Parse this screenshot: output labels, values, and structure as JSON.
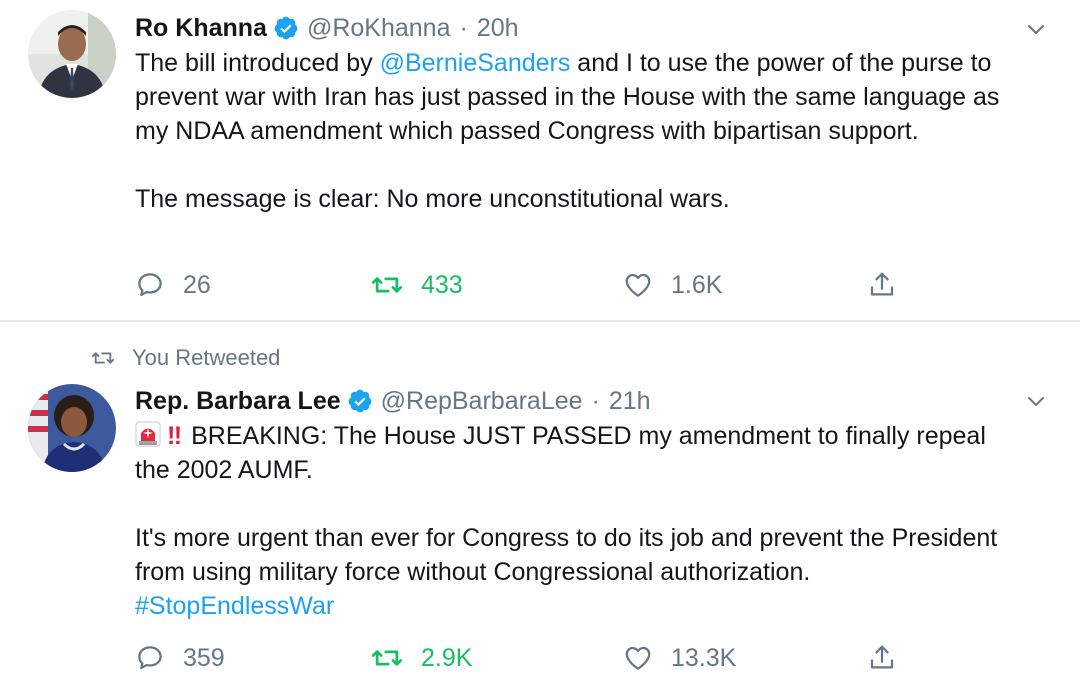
{
  "tweets": [
    {
      "display_name": "Ro Khanna",
      "handle": "@RoKhanna",
      "separator": "·",
      "time": "20h",
      "text_before_mention": "The bill introduced by ",
      "mention": "@BernieSanders",
      "text_after_mention": " and I to use the power of the purse to prevent war with Iran has just passed in the House with the same language as my NDAA amendment which passed Congress with bipartisan support.",
      "paragraph_2": "The message is clear: No more unconstitutional wars.",
      "reply_count": "26",
      "retweet_count": "433",
      "like_count": "1.6K",
      "retweeted": true
    },
    {
      "social_context": "You Retweeted",
      "display_name": "Rep. Barbara Lee",
      "handle": "@RepBarbaraLee",
      "separator": "·",
      "time": "21h",
      "emoji_bangbang": "‼",
      "text_1": "BREAKING: The House JUST PASSED my amendment to finally repeal the 2002 AUMF.",
      "paragraph_2": "It's more urgent than ever for Congress to do its job and prevent the President from using military force without Congressional authorization.",
      "hashtag": "#StopEndlessWar",
      "reply_count": "359",
      "retweet_count": "2.9K",
      "like_count": "13.3K",
      "retweeted": true
    }
  ],
  "icons": {
    "verified": "verified-badge-icon",
    "caret": "chevron-down-icon",
    "reply": "reply-bubble-icon",
    "retweet": "retweet-arrows-icon",
    "like": "heart-outline-icon",
    "share": "share-upload-icon",
    "siren": "rotating-light-emoji"
  },
  "colors": {
    "link_blue": "#1da1f2",
    "retweet_green": "#17bf63",
    "muted_gray": "#657786",
    "text_dark": "#14171a",
    "divider": "#e6ecf0"
  }
}
